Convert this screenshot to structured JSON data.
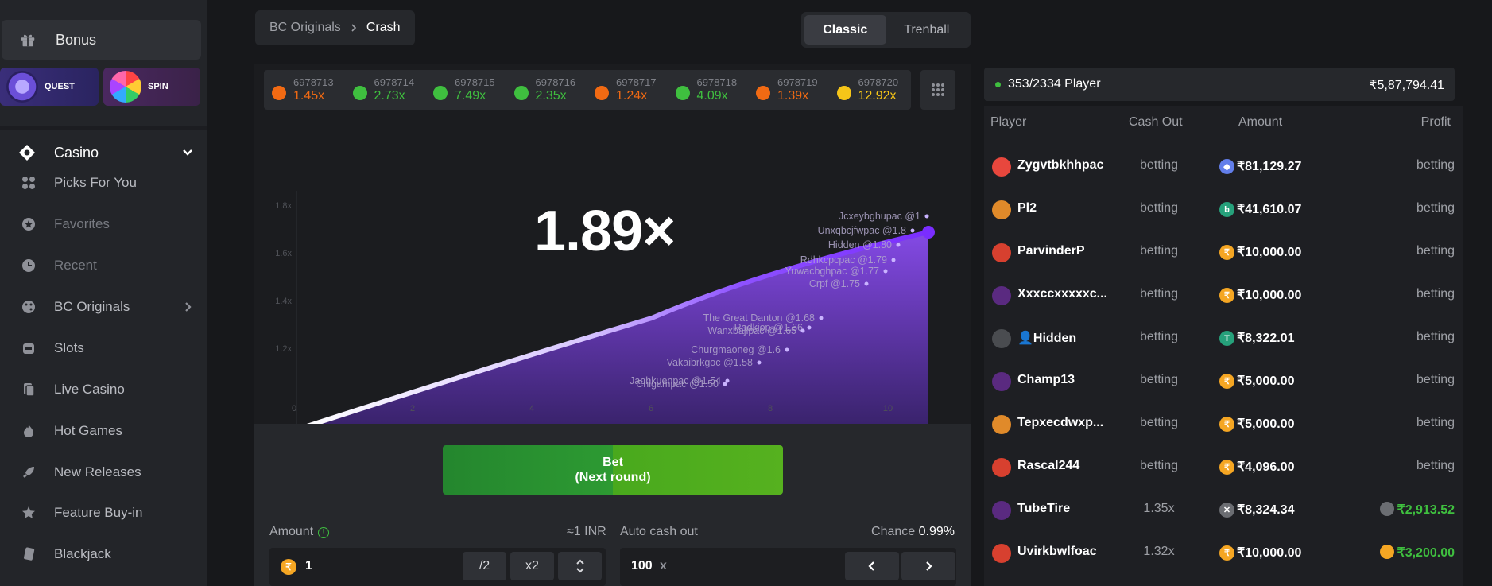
{
  "sidebar": {
    "bonus_label": "Bonus",
    "quest_label": "QUEST",
    "spin_label": "SPIN",
    "casino_label": "Casino",
    "items": [
      {
        "label": "Picks For You",
        "icon": "grid-dots-icon",
        "dim": false
      },
      {
        "label": "Favorites",
        "icon": "star-icon",
        "dim": true
      },
      {
        "label": "Recent",
        "icon": "clock-icon",
        "dim": true
      },
      {
        "label": "BC Originals",
        "icon": "dice-icon",
        "dim": false
      },
      {
        "label": "Slots",
        "icon": "slot-machine-icon",
        "dim": false
      },
      {
        "label": "Live Casino",
        "icon": "cards-icon",
        "dim": false
      },
      {
        "label": "Hot Games",
        "icon": "flame-icon",
        "dim": false
      },
      {
        "label": "New Releases",
        "icon": "rocket-icon",
        "dim": false
      },
      {
        "label": "Feature Buy-in",
        "icon": "star-badge-icon",
        "dim": false
      },
      {
        "label": "Blackjack",
        "icon": "card-icon",
        "dim": false
      }
    ]
  },
  "breadcrumb": {
    "parent": "BC Originals",
    "current": "Crash"
  },
  "mode_tabs": {
    "classic": "Classic",
    "trenball": "Trenball"
  },
  "history": [
    {
      "id": "6978713",
      "mult": "1.45x",
      "color": "#f16a13"
    },
    {
      "id": "6978714",
      "mult": "2.73x",
      "color": "#3fbf3f"
    },
    {
      "id": "6978715",
      "mult": "7.49x",
      "color": "#3fbf3f"
    },
    {
      "id": "6978716",
      "mult": "2.35x",
      "color": "#3fbf3f"
    },
    {
      "id": "6978717",
      "mult": "1.24x",
      "color": "#f16a13"
    },
    {
      "id": "6978718",
      "mult": "4.09x",
      "color": "#3fbf3f"
    },
    {
      "id": "6978719",
      "mult": "1.39x",
      "color": "#f16a13"
    },
    {
      "id": "6978720",
      "mult": "12.92x",
      "color": "#f5c518"
    }
  ],
  "graph": {
    "current_multiplier": "1.89×",
    "y_ticks": [
      "1.8x",
      "1.6x",
      "1.4x",
      "1.2x"
    ],
    "x_ticks": [
      "0",
      "2",
      "4",
      "6",
      "8",
      "10"
    ],
    "cashouts": [
      "Jcxeybghupac @1",
      "Unxqbcjfwpac @1.8",
      "Hidden @1.80",
      "Rdhkcpcpac @1.79",
      "Yuwacbghpac @1.77",
      "Crpf @1.75",
      "The Great Danton @1.68",
      "Radkiop @1.66",
      "Wanxbajlpac @1.65",
      "Churgmaoneg @1.6",
      "Vakaibrkgoc @1.58",
      "Jaohkuenpac @1.54",
      "Chigampac @1.50"
    ]
  },
  "bet_panel": {
    "bet_label": "Bet",
    "bet_sublabel": "(Next round)",
    "amount_label": "Amount",
    "inr_hint": "≈1 INR",
    "amount_value": "1",
    "half_label": "/2",
    "double_label": "x2",
    "auto_label": "Auto cash out",
    "chance_label": "Chance",
    "chance_value": "0.99%",
    "auto_value": "100",
    "auto_unit": "x"
  },
  "players_panel": {
    "count": "353/2334 Player",
    "total": "₹5,87,794.41",
    "headers": {
      "player": "Player",
      "cashout": "Cash Out",
      "amount": "Amount",
      "profit": "Profit"
    },
    "rows": [
      {
        "name": "Zygvtbkhhpac",
        "cashout": "betting",
        "amount": "₹81,129.27",
        "coin": "eth-icon",
        "coin_color": "#627eea",
        "profit": "betting",
        "avatar": "#e8473d"
      },
      {
        "name": "Pl2",
        "cashout": "betting",
        "amount": "₹41,610.07",
        "coin": "b-coin-icon",
        "coin_color": "#26a17b",
        "profit": "betting",
        "avatar": "#e08a2a"
      },
      {
        "name": "ParvinderP",
        "cashout": "betting",
        "amount": "₹10,000.00",
        "coin": "rupee-icon",
        "coin_color": "#f5a623",
        "profit": "betting",
        "avatar": "#d7402f"
      },
      {
        "name": "Xxxccxxxxxc...",
        "cashout": "betting",
        "amount": "₹10,000.00",
        "coin": "rupee-icon",
        "coin_color": "#f5a623",
        "profit": "betting",
        "avatar": "#5a2a80"
      },
      {
        "name": "👤Hidden",
        "cashout": "betting",
        "amount": "₹8,322.01",
        "coin": "tether-icon",
        "coin_color": "#26a17b",
        "profit": "betting",
        "avatar": "#4a4c50"
      },
      {
        "name": "Champ13",
        "cashout": "betting",
        "amount": "₹5,000.00",
        "coin": "rupee-icon",
        "coin_color": "#f5a623",
        "profit": "betting",
        "avatar": "#5a2a80"
      },
      {
        "name": "Tepxecdwxp...",
        "cashout": "betting",
        "amount": "₹5,000.00",
        "coin": "rupee-icon",
        "coin_color": "#f5a623",
        "profit": "betting",
        "avatar": "#e08a2a"
      },
      {
        "name": "Rascal244",
        "cashout": "betting",
        "amount": "₹4,096.00",
        "coin": "rupee-icon",
        "coin_color": "#f5a623",
        "profit": "betting",
        "avatar": "#d7402f"
      },
      {
        "name": "TubeTire",
        "cashout": "1.35x",
        "amount": "₹8,324.34",
        "coin": "x-coin-icon",
        "coin_color": "#6b6d72",
        "profit": "₹2,913.52",
        "avatar": "#5a2a80",
        "win": true
      },
      {
        "name": "Uvirkbwlfoac",
        "cashout": "1.32x",
        "amount": "₹10,000.00",
        "coin": "rupee-icon",
        "coin_color": "#f5a623",
        "profit": "₹3,200.00",
        "avatar": "#d7402f",
        "win": true
      }
    ]
  }
}
